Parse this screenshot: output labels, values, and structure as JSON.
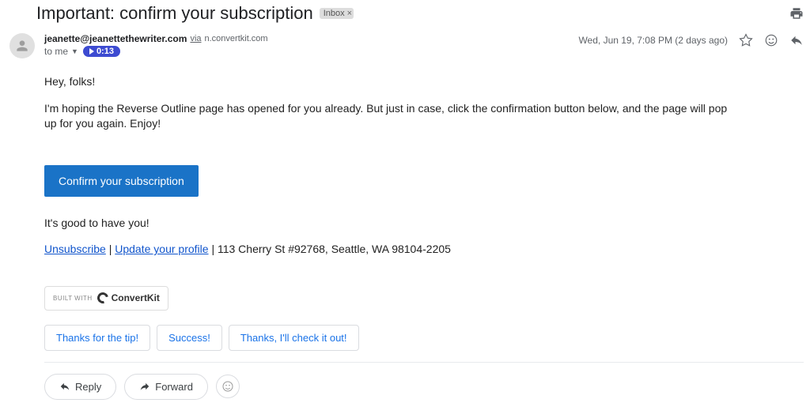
{
  "subject": "Important: confirm your subscription",
  "label": "Inbox",
  "sender": {
    "email": "jeanette@jeanettethewriter.com",
    "via_text": "via",
    "via_domain": "n.convertkit.com",
    "to": "to me",
    "time_pill": "0:13"
  },
  "meta": {
    "timestamp": "Wed, Jun 19, 7:08 PM (2 days ago)"
  },
  "body": {
    "greeting": "Hey, folks!",
    "para1": "I'm hoping the Reverse Outline page has opened for you already. But just in case, click the confirmation button below, and the page will pop up for you again. Enjoy!",
    "confirm_button": "Confirm your subscription",
    "outro": "It's good to have you!",
    "unsubscribe": "Unsubscribe",
    "update": "Update your profile",
    "address": "113 Cherry St #92768, Seattle, WA 98104-2205",
    "builtwith": "BUILT WITH",
    "convertkit": "ConvertKit"
  },
  "suggestions": [
    "Thanks for the tip!",
    "Success!",
    "Thanks, I'll check it out!"
  ],
  "actions": {
    "reply": "Reply",
    "forward": "Forward"
  }
}
